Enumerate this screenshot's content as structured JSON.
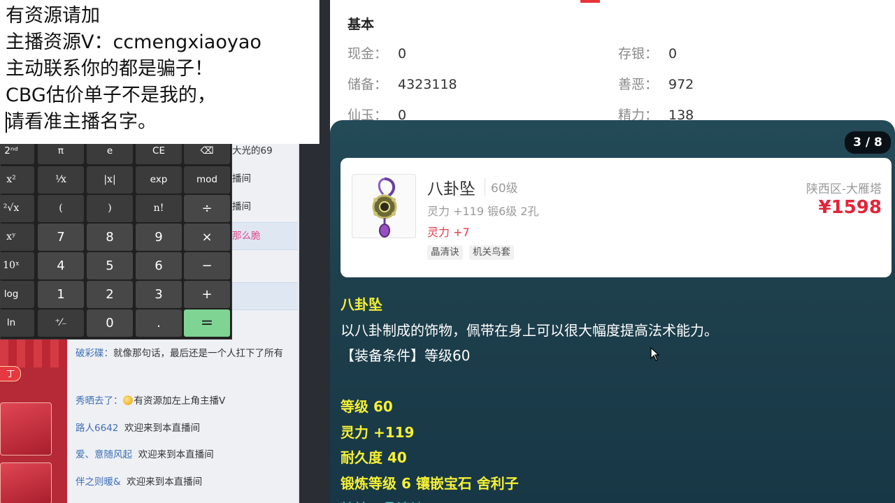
{
  "notepad": {
    "lines": [
      "有资源请加",
      "主播资源V：ccmengxiaoyao",
      "主动联系你的都是骗子！",
      "CBG估价单子不是我的，",
      "请看准主播名字。"
    ]
  },
  "chat": {
    "messages": [
      {
        "user": "",
        "text": "大光的69"
      },
      {
        "user": "",
        "text": "播间"
      },
      {
        "user": "",
        "text": "播间"
      },
      {
        "user": "",
        "text": "那么脆"
      },
      {
        "user": "破彩碟：",
        "text": "就像那句话，最后还是一个人扛下了所有"
      },
      {
        "user": "秀晒去了：",
        "text": "有资源加左上角主播V"
      },
      {
        "user": "路人6642",
        "text": "欢迎来到本直播间"
      },
      {
        "user": "爱、意随风起",
        "text": "欢迎来到本直播间"
      },
      {
        "user": "伴之则暖&",
        "text": "欢迎来到本直播间"
      }
    ],
    "red_button": "丁"
  },
  "calculator": {
    "keys": [
      [
        "2ⁿᵈ",
        "π",
        "e",
        "CE",
        "⌫"
      ],
      [
        "x²",
        "¹⁄x",
        "|x|",
        "exp",
        "mod"
      ],
      [
        "²√x",
        "(",
        ")",
        "n!",
        "÷"
      ],
      [
        "xʸ",
        "7",
        "8",
        "9",
        "×"
      ],
      [
        "10ˣ",
        "4",
        "5",
        "6",
        "−"
      ],
      [
        "log",
        "1",
        "2",
        "3",
        "+"
      ],
      [
        "ln",
        "⁺⁄₋",
        "0",
        ".",
        "="
      ]
    ]
  },
  "basic": {
    "title": "基本",
    "fields": [
      {
        "label": "现金：",
        "value": "0"
      },
      {
        "label": "存银：",
        "value": "0"
      },
      {
        "label": "储备：",
        "value": "4323118"
      },
      {
        "label": "善恶：",
        "value": "972"
      },
      {
        "label": "仙玉：",
        "value": "0"
      },
      {
        "label": "精力：",
        "value": "138"
      }
    ]
  },
  "item": {
    "pager": "3 / 8",
    "name": "八卦坠",
    "level": "60级",
    "attrs": "灵力 +119 锻6级 2孔",
    "bonus": "灵力 +7",
    "tags": [
      "晶清诀",
      "机关鸟套"
    ],
    "server": "陕西区-大雁塔",
    "price": "¥1598",
    "desc_title": "八卦坠",
    "desc_text": "以八卦制成的饰物，佩带在身上可以很大幅度提高法术能力。",
    "equip_req": "【装备条件】等级60",
    "stats": [
      "等级 60",
      "灵力 +119",
      "耐久度 40",
      "锻炼等级 6 镶嵌宝石 舍利子"
    ],
    "special": "特技：晶清诀"
  },
  "colors": {
    "price_red": "#e3243a",
    "stat_yellow": "#f6f035",
    "panel_teal": "#1e3f4c",
    "calc_equals": "#7fd493"
  }
}
